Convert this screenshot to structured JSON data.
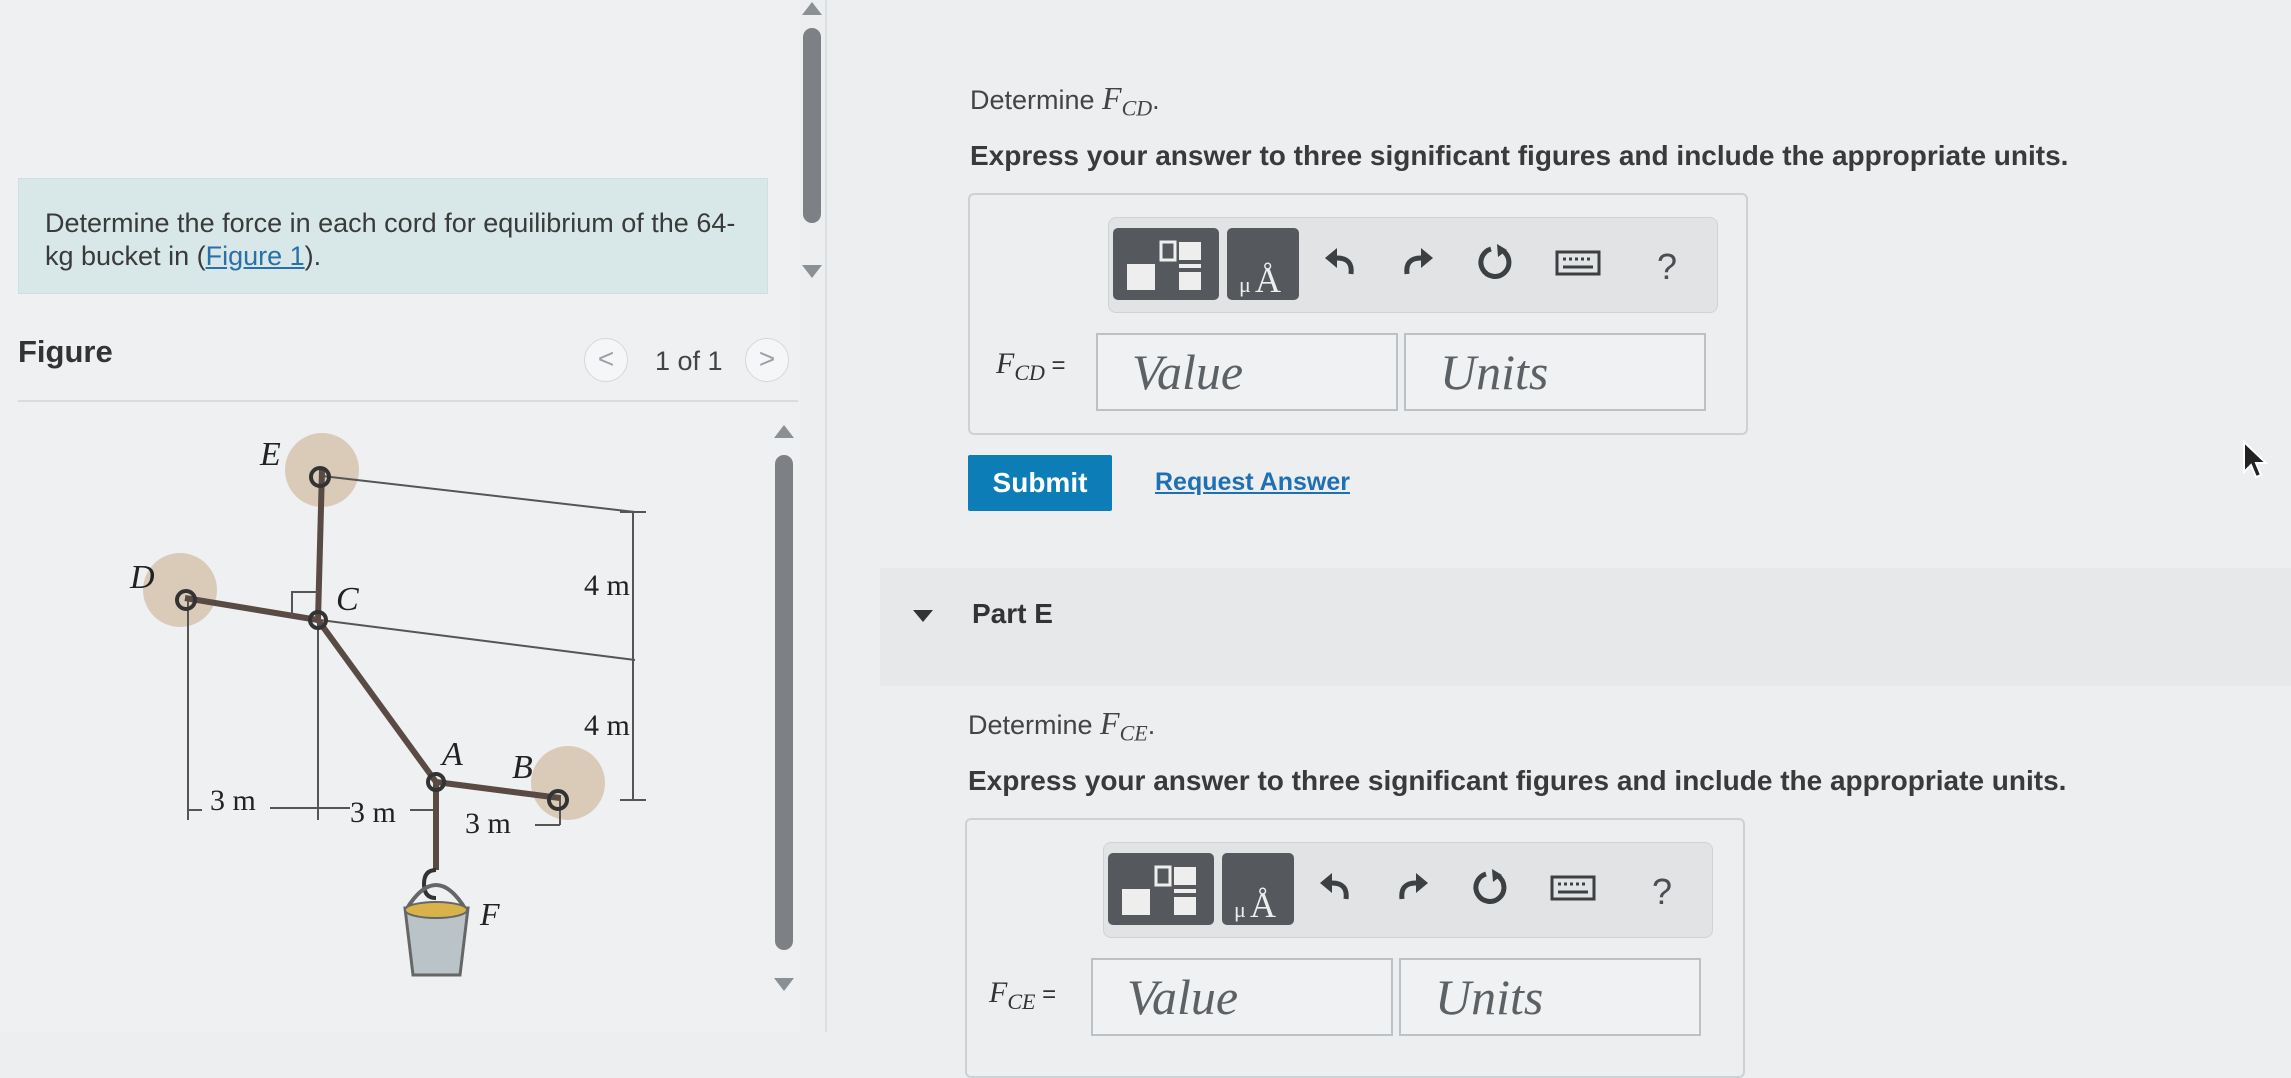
{
  "problem": {
    "text_before": "Determine the force in each cord for equilibrium of the 64-kg bucket in (",
    "link": "Figure 1",
    "text_after": ")."
  },
  "figure": {
    "label": "Figure",
    "counter": "1 of 1",
    "prev_glyph": "<",
    "next_glyph": ">",
    "labels": {
      "E": "E",
      "D": "D",
      "C": "C",
      "A": "A",
      "B": "B",
      "F": "F",
      "dim_top": "4 m",
      "dim_mid": "4 m",
      "dim_3a": "3 m",
      "dim_3b": "3 m",
      "dim_3c": "3 m"
    }
  },
  "part_d": {
    "question_prefix": "Determine ",
    "question_var": "F",
    "question_sub": "CD",
    "question_suffix": ".",
    "instructions": "Express your answer to three significant figures and include the appropriate units.",
    "field_var": "F",
    "field_sub": "CD",
    "field_eq": " =",
    "value_placeholder": "Value",
    "units_placeholder": "Units",
    "help": "?",
    "submit": "Submit",
    "request_answer": "Request Answer"
  },
  "part_e": {
    "title": "Part E",
    "question_prefix": "Determine ",
    "question_var": "F",
    "question_sub": "CE",
    "question_suffix": ".",
    "instructions": "Express your answer to three significant figures and include the appropriate units.",
    "field_var": "F",
    "field_sub": "CE",
    "field_eq": " =",
    "value_placeholder": "Value",
    "units_placeholder": "Units",
    "help": "?"
  },
  "toolbar_icons": [
    "templates-icon",
    "units-angstrom-icon",
    "undo-icon",
    "redo-icon",
    "reset-icon",
    "keyboard-icon",
    "help-icon"
  ],
  "colors": {
    "submit": "#0d7db7",
    "link": "#1f6fb3",
    "problem_bg": "#d8e8e8"
  }
}
